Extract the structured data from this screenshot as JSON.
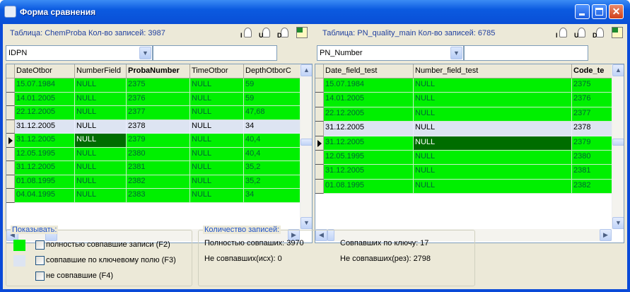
{
  "window": {
    "title": "Форма сравнения"
  },
  "colors": {
    "match": "#00f000",
    "key": "#dde4f2",
    "focus": "#006d00",
    "selected_marker": "#000"
  },
  "toolbar": {
    "insert_letter": "I",
    "update_letter": "U",
    "delete_letter": "D"
  },
  "left": {
    "label": "Таблица: ChemProba  Кол-во записей: 3987",
    "key_field": "IDPN",
    "filter": "",
    "columns": [
      "DateOtbor",
      "NumberField",
      "ProbaNumber",
      "TimeOtbor",
      "DepthOtborC"
    ],
    "rows": [
      {
        "state": "match",
        "cells": [
          "15.07.1984",
          "NULL",
          "2375",
          "NULL",
          "59"
        ]
      },
      {
        "state": "match",
        "cells": [
          "14.01.2005",
          "NULL",
          "2376",
          "NULL",
          "59"
        ]
      },
      {
        "state": "match",
        "cells": [
          "22.12.2005",
          "NULL",
          "2377",
          "NULL",
          "47,68"
        ]
      },
      {
        "state": "key",
        "cells": [
          "31.12.2005",
          "NULL",
          "2378",
          "NULL",
          "34"
        ]
      },
      {
        "state": "match",
        "selected": true,
        "cells": [
          "31.12.2005",
          "NULL",
          "2379",
          "NULL",
          "40,4"
        ]
      },
      {
        "state": "match",
        "cells": [
          "12.05.1995",
          "NULL",
          "2380",
          "NULL",
          "40,4"
        ]
      },
      {
        "state": "match",
        "cells": [
          "31.12.2005",
          "NULL",
          "2381",
          "NULL",
          "35,2"
        ]
      },
      {
        "state": "match",
        "cells": [
          "01.08.1995",
          "NULL",
          "2382",
          "NULL",
          "35,2"
        ]
      },
      {
        "state": "match",
        "cells": [
          "04.04.1995",
          "NULL",
          "2383",
          "NULL",
          "34"
        ]
      }
    ]
  },
  "right": {
    "label": "Таблица: PN_quality_main  Кол-во записей: 6785",
    "key_field": "PN_Number",
    "filter": "",
    "columns": [
      "Date_field_test",
      "Number_field_test",
      "Code_te"
    ],
    "rows": [
      {
        "state": "match",
        "cells": [
          "15.07.1984",
          "NULL",
          "2375"
        ]
      },
      {
        "state": "match",
        "cells": [
          "14.01.2005",
          "NULL",
          "2376"
        ]
      },
      {
        "state": "match",
        "cells": [
          "22.12.2005",
          "NULL",
          "2377"
        ]
      },
      {
        "state": "key",
        "cells": [
          "31.12.2005",
          "NULL",
          "2378"
        ]
      },
      {
        "state": "match",
        "selected": true,
        "cells": [
          "31.12.2005",
          "NULL",
          "2379"
        ]
      },
      {
        "state": "match",
        "cells": [
          "12.05.1995",
          "NULL",
          "2380"
        ]
      },
      {
        "state": "match",
        "cells": [
          "31.12.2005",
          "NULL",
          "2381"
        ]
      },
      {
        "state": "match",
        "cells": [
          "01.08.1995",
          "NULL",
          "2382"
        ]
      }
    ]
  },
  "show": {
    "title": "Показывать:",
    "options": [
      {
        "label": "полностью совпавшие записи (F2)",
        "checked": false
      },
      {
        "label": "совпавшие по ключевому полю (F3)",
        "checked": false
      },
      {
        "label": "не совпавшие (F4)",
        "checked": false
      }
    ]
  },
  "counts": {
    "title": "Количество записей:",
    "full_match": "Полностью совпаших: 3970",
    "key_match": "Совпавших по ключу: 17",
    "no_match_src": "Не совпавших(исх): 0",
    "no_match_res": "Не совпавших(рез): 2798"
  }
}
